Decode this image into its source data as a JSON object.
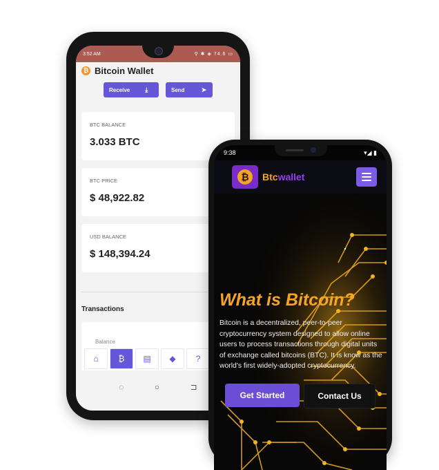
{
  "wallet_app": {
    "status": {
      "time": "3:52 AM",
      "right": "⚲ ✱ ◈ 74.6 ▭"
    },
    "title": "Bitcoin Wallet",
    "title_icon": "bitcoin-icon",
    "actions": [
      {
        "label": "Receive",
        "icon": "download-icon"
      },
      {
        "label": "Send",
        "icon": "send-icon"
      }
    ],
    "cards": [
      {
        "label": "BTC BALANCE",
        "value": "3.033 BTC"
      },
      {
        "label": "BTC PRICE",
        "value": "$ 48,922.82"
      },
      {
        "label": "USD BALANCE",
        "value": "$ 148,394.24"
      }
    ],
    "transactions_heading": "Transactions",
    "transaction_card_label": "Balance",
    "nav": [
      {
        "icon": "home-icon",
        "glyph": "⌂",
        "active": false
      },
      {
        "icon": "bitcoin-icon",
        "glyph": "₿",
        "active": true
      },
      {
        "icon": "archive-icon",
        "glyph": "▤",
        "active": false
      },
      {
        "icon": "tag-icon",
        "glyph": "◆",
        "active": false
      },
      {
        "icon": "help-icon",
        "glyph": "?",
        "active": false
      }
    ],
    "system_nav": [
      "◌",
      "○",
      "⊐"
    ]
  },
  "website": {
    "status": {
      "time": "9:38",
      "right": "▾◢ ▮"
    },
    "logo_text_prefix": "Btc",
    "logo_text_suffix": "wallet",
    "logo_icon": "bitcoin-icon",
    "menu_icon": "hamburger-menu-icon",
    "hero_title": "What is Bitcoin?",
    "hero_body": "Bitcoin is a decentralized, peer-to-peer cryptocurrency system designed to allow online users to process transactions through digital units of exchange called bitcoins (BTC). It is know as the world's first widely-adopted cryptocurrency.",
    "primary_cta": "Get Started",
    "secondary_cta": "Contact Us"
  },
  "colors": {
    "accent_purple": "#6656d8",
    "bitcoin_orange": "#f5a524",
    "status_bar_red": "#ad5a52",
    "circuit_gold": "#f1b01e"
  }
}
